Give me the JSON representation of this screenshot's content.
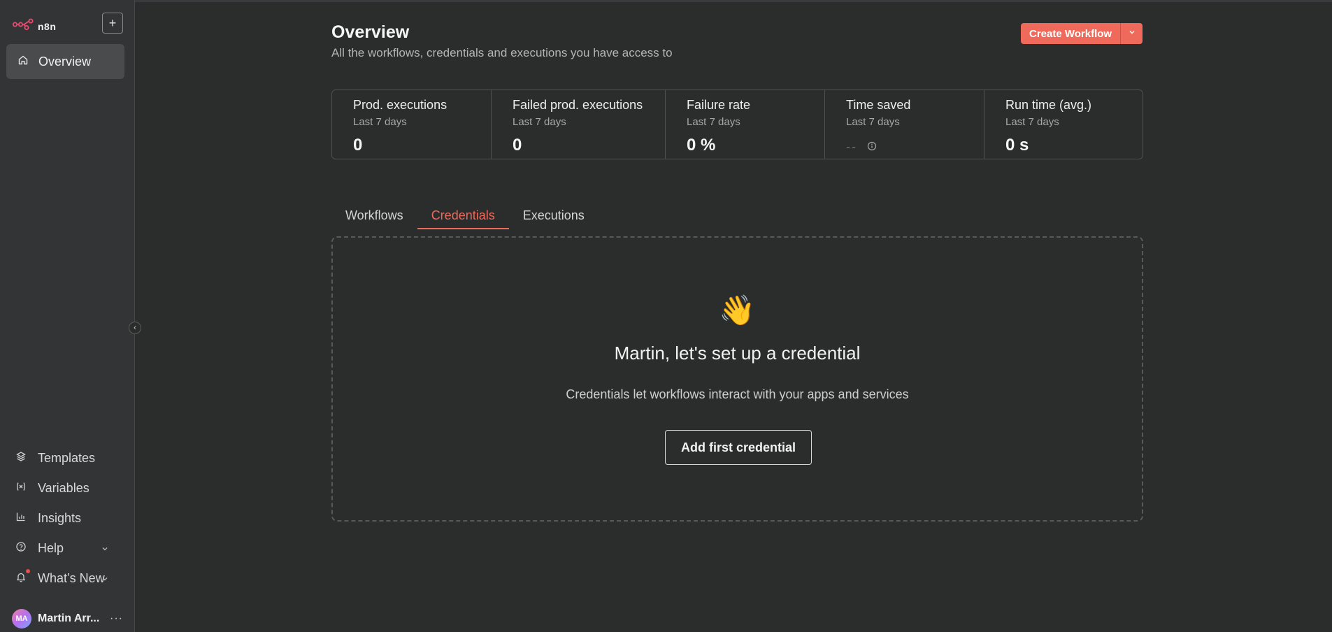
{
  "app": {
    "logo_text": "n8n"
  },
  "sidebar": {
    "new_button_label": "+",
    "overview_label": "Overview",
    "items": [
      {
        "label": "Templates",
        "icon": "box-icon"
      },
      {
        "label": "Variables",
        "icon": "variables-icon"
      },
      {
        "label": "Insights",
        "icon": "chart-icon"
      },
      {
        "label": "Help",
        "icon": "help-circle-icon"
      },
      {
        "label": "What’s New",
        "icon": "bell-icon"
      }
    ],
    "user": {
      "initials": "MA",
      "name": "Martin Arr...",
      "more": "···"
    }
  },
  "header": {
    "title": "Overview",
    "subtitle": "All the workflows, credentials and executions you have access to",
    "create_button": "Create Workflow"
  },
  "stats": [
    {
      "label": "Prod. executions",
      "period": "Last 7 days",
      "value": "0"
    },
    {
      "label": "Failed prod. executions",
      "period": "Last 7 days",
      "value": "0"
    },
    {
      "label": "Failure rate",
      "period": "Last 7 days",
      "value": "0 %"
    },
    {
      "label": "Time saved",
      "period": "Last 7 days",
      "value": "--"
    },
    {
      "label": "Run time (avg.)",
      "period": "Last 7 days",
      "value": "0 s"
    }
  ],
  "tabs": [
    {
      "label": "Workflows",
      "active": false
    },
    {
      "label": "Credentials",
      "active": true
    },
    {
      "label": "Executions",
      "active": false
    }
  ],
  "empty_state": {
    "emoji": "👋",
    "title": "Martin, let's set up a credential",
    "description": "Credentials let workflows interact with your apps and services",
    "button": "Add first credential"
  },
  "colors": {
    "accent": "#ef6a5b",
    "background": "#2b2c2c",
    "sidebar": "#333435"
  }
}
